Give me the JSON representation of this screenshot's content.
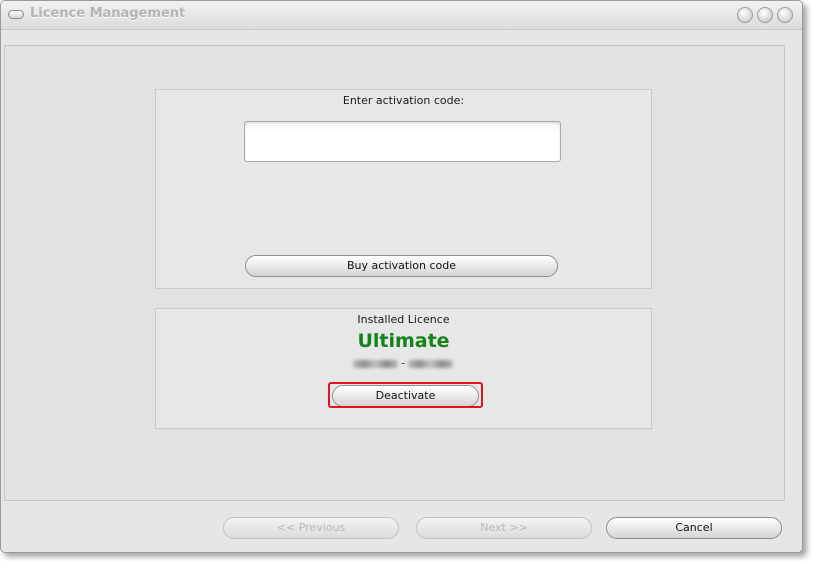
{
  "window": {
    "title": "Licence Management"
  },
  "activation": {
    "prompt": "Enter activation code:",
    "code_value": "",
    "buy_label": "Buy activation code"
  },
  "licence": {
    "header": "Installed Licence",
    "name": "Ultimate",
    "code_separator": "-",
    "deactivate_label": "Deactivate"
  },
  "footer": {
    "previous_label": "<< Previous",
    "next_label": "Next >>",
    "cancel_label": "Cancel"
  },
  "colors": {
    "licence_name": "#14831a",
    "highlight": "#e0141e"
  }
}
